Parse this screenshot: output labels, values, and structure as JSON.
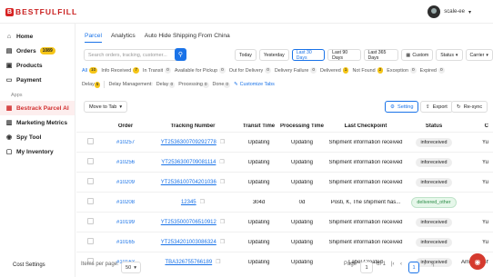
{
  "brand": {
    "mark": "B",
    "text": "BESTFULFILL"
  },
  "user": {
    "name": "scale-ee",
    "chevron": "▾"
  },
  "sidebar": {
    "items": [
      {
        "label": "Home",
        "icon": "home-icon",
        "glyph": "⌂"
      },
      {
        "label": "Orders",
        "icon": "orders-icon",
        "glyph": "▤",
        "badge": "1089"
      },
      {
        "label": "Products",
        "icon": "products-icon",
        "glyph": "▣"
      },
      {
        "label": "Payment",
        "icon": "payment-icon",
        "glyph": "▭"
      }
    ],
    "apps_heading": "Apps",
    "apps": [
      {
        "label": "Bestrack Parcel AI",
        "icon": "parcel-icon",
        "glyph": "▦",
        "active": true
      },
      {
        "label": "Marketing Metrics",
        "icon": "metrics-icon",
        "glyph": "▥"
      },
      {
        "label": "Spy Tool",
        "icon": "spy-icon",
        "glyph": "◉"
      },
      {
        "label": "My Inventory",
        "icon": "inventory-icon",
        "glyph": "▢"
      }
    ],
    "cost_settings": "Cost Settings"
  },
  "tabs": [
    "Parcel",
    "Analytics",
    "Auto Hide Shipping From China"
  ],
  "search": {
    "placeholder": "Search orders, tracking, customer...",
    "icon": "search-icon",
    "glyph": "⚲"
  },
  "date_ranges": [
    "Today",
    "Yesterday",
    "Last 30 Days",
    "Last 90 Days",
    "Last 365 Days"
  ],
  "custom": {
    "label": "Custom",
    "glyph": "▦"
  },
  "status_select": "Status",
  "carrier_select": "Carrier",
  "status_filters": [
    {
      "label": "All",
      "count": "10"
    },
    {
      "label": "Info Received",
      "count": "7"
    },
    {
      "label": "In Transit",
      "count": "0"
    },
    {
      "label": "Available for Pickup",
      "count": "0"
    },
    {
      "label": "Out for Delivery",
      "count": "0"
    },
    {
      "label": "Delivery Failure",
      "count": "0"
    },
    {
      "label": "Delivered",
      "count": "1"
    },
    {
      "label": "Not Found",
      "count": "2"
    },
    {
      "label": "Exception",
      "count": "0"
    },
    {
      "label": "Expired",
      "count": "0"
    }
  ],
  "delay_filters": {
    "delay": {
      "label": "Delay",
      "count": "5"
    },
    "mgmt_label": "Delay Management:",
    "items": [
      {
        "label": "Delay",
        "count": "0"
      },
      {
        "label": "Processing",
        "count": "0"
      },
      {
        "label": "Done",
        "count": "0"
      }
    ],
    "customize": "Customize Tabs"
  },
  "toolbar": {
    "move_to_tab": "Move to Tab",
    "setting": "Setting",
    "export": "Export",
    "resync": "Re-sync"
  },
  "columns": [
    "Order",
    "Tracking Number",
    "Transit Time",
    "Processing Time",
    "Last Checkpoint",
    "Status",
    "C"
  ],
  "rows": [
    {
      "order": "#10257",
      "tracking": "YT2536300709292778",
      "transit": "Updating",
      "processing": "Updating",
      "checkpoint": "Shipment information received",
      "status": "inforeceived",
      "carrier": "Yu"
    },
    {
      "order": "#10256",
      "tracking": "YT2536300709081114",
      "transit": "Updating",
      "processing": "Updating",
      "checkpoint": "Shipment information received",
      "status": "inforeceived",
      "carrier": "Yu"
    },
    {
      "order": "#10209",
      "tracking": "YT2536100704201036",
      "transit": "Updating",
      "processing": "Updating",
      "checkpoint": "Shipment information received",
      "status": "inforeceived",
      "carrier": "Yu"
    },
    {
      "order": "#10208",
      "tracking": "12345",
      "transit": "304d",
      "processing": "0d",
      "checkpoint": "Posti, K, The shipment has...",
      "status": "delivered_other",
      "carrier": ""
    },
    {
      "order": "#10199",
      "tracking": "YT2535000706510912",
      "transit": "Updating",
      "processing": "Updating",
      "checkpoint": "Shipment information received",
      "status": "inforeceived",
      "carrier": "Yu"
    },
    {
      "order": "#10165",
      "tracking": "YT2534201003086324",
      "transit": "Updating",
      "processing": "Updating",
      "checkpoint": "Shipment information received",
      "status": "inforeceived",
      "carrier": "Yu"
    },
    {
      "order": "#10163",
      "tracking": "TBA326755766189",
      "transit": "Updating",
      "processing": "Updating",
      "checkpoint": "Label Created",
      "status": "inforeceived",
      "carrier": "Amazon Ship"
    }
  ],
  "pagination": {
    "items_label": "Items per page:",
    "per_page": "50",
    "page_label": "Page",
    "page": "1",
    "of": "of 1",
    "current": "1"
  },
  "colors": {
    "brand": "#d72222",
    "accent": "#1a73e8",
    "badge": "#f5c518",
    "chat": "#d53a2e"
  }
}
